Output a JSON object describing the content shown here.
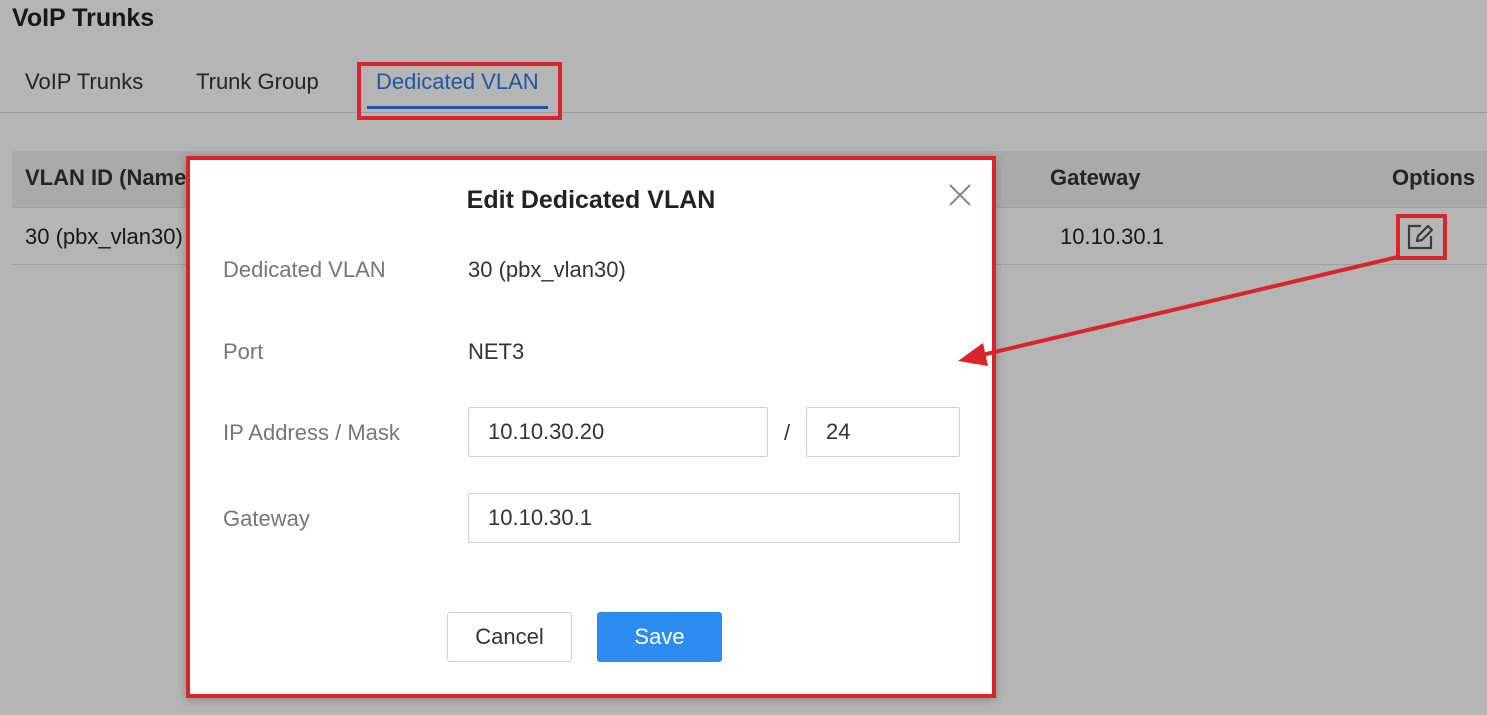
{
  "page": {
    "title": "VoIP Trunks"
  },
  "tabs": [
    {
      "label": "VoIP Trunks"
    },
    {
      "label": "Trunk Group"
    },
    {
      "label": "Dedicated VLAN"
    }
  ],
  "table": {
    "headers": {
      "vlan_id": "VLAN ID (Name",
      "gateway": "Gateway",
      "options": "Options"
    },
    "rows": [
      {
        "vlan_id": "30 (pbx_vlan30)",
        "gateway": "10.10.30.1"
      }
    ]
  },
  "modal": {
    "title": "Edit Dedicated VLAN",
    "fields": {
      "dedicated_vlan": {
        "label": "Dedicated VLAN",
        "value": "30 (pbx_vlan30)"
      },
      "port": {
        "label": "Port",
        "value": "NET3"
      },
      "ip_mask": {
        "label": "IP Address / Mask",
        "ip": "10.10.30.20",
        "separator": "/",
        "mask": "24"
      },
      "gateway": {
        "label": "Gateway",
        "value": "10.10.30.1"
      }
    },
    "buttons": {
      "cancel": "Cancel",
      "save": "Save"
    }
  },
  "colors": {
    "accent": "#2d7be5",
    "save_button": "#2d8cf0",
    "highlight": "#d9242a",
    "overlay": "rgba(0,0,0,0.29)"
  },
  "icons": {
    "edit": "edit-icon",
    "close": "close-icon"
  }
}
